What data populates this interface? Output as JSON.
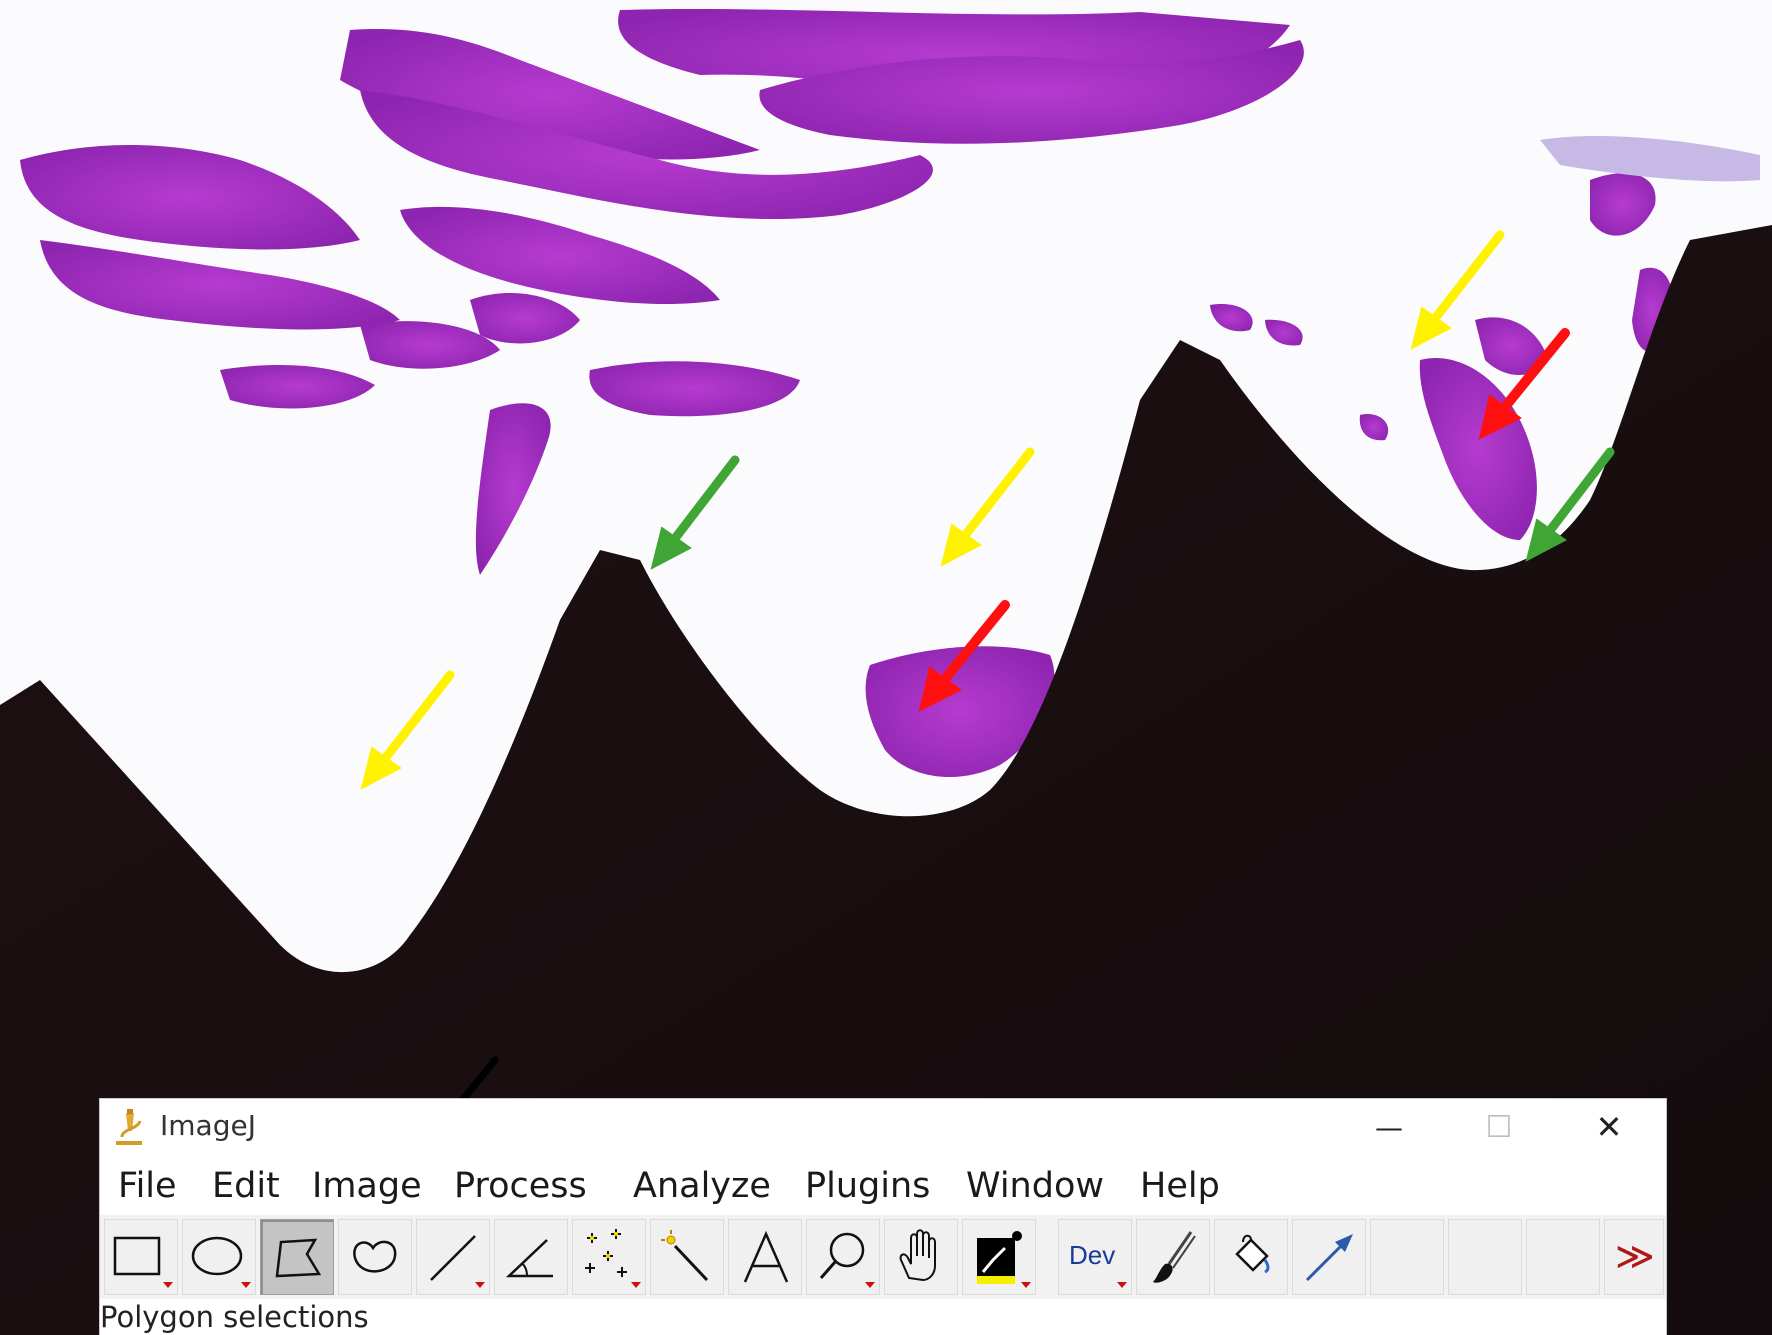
{
  "window": {
    "title": "ImageJ",
    "minimize_glyph": "—",
    "maximize_glyph": "☐",
    "close_glyph": "✕"
  },
  "menu": [
    "File",
    "Edit",
    "Image",
    "Process",
    "Analyze",
    "Plugins",
    "Window",
    "Help"
  ],
  "toolbar": {
    "active_tool": "polygon",
    "tools": [
      "rectangle-icon",
      "oval-icon",
      "polygon-icon",
      "freehand-icon",
      "line-icon",
      "angle-icon",
      "multipoint-icon",
      "wand-icon",
      "text-icon",
      "magnifier-icon",
      "hand-icon",
      "color-picker-icon",
      "dev-icon",
      "brush-icon",
      "flood-fill-icon",
      "arrow-icon",
      "empty-slot",
      "empty-slot",
      "empty-slot",
      "more-tools-icon"
    ],
    "dev_label": "Dev",
    "more_glyph": "≫"
  },
  "status": {
    "text": "Polygon selections"
  },
  "annotations": {
    "arrow_colors": {
      "yellow": "#fff200",
      "green": "#3fa535",
      "red": "#ff1010",
      "black": "#000000"
    }
  }
}
